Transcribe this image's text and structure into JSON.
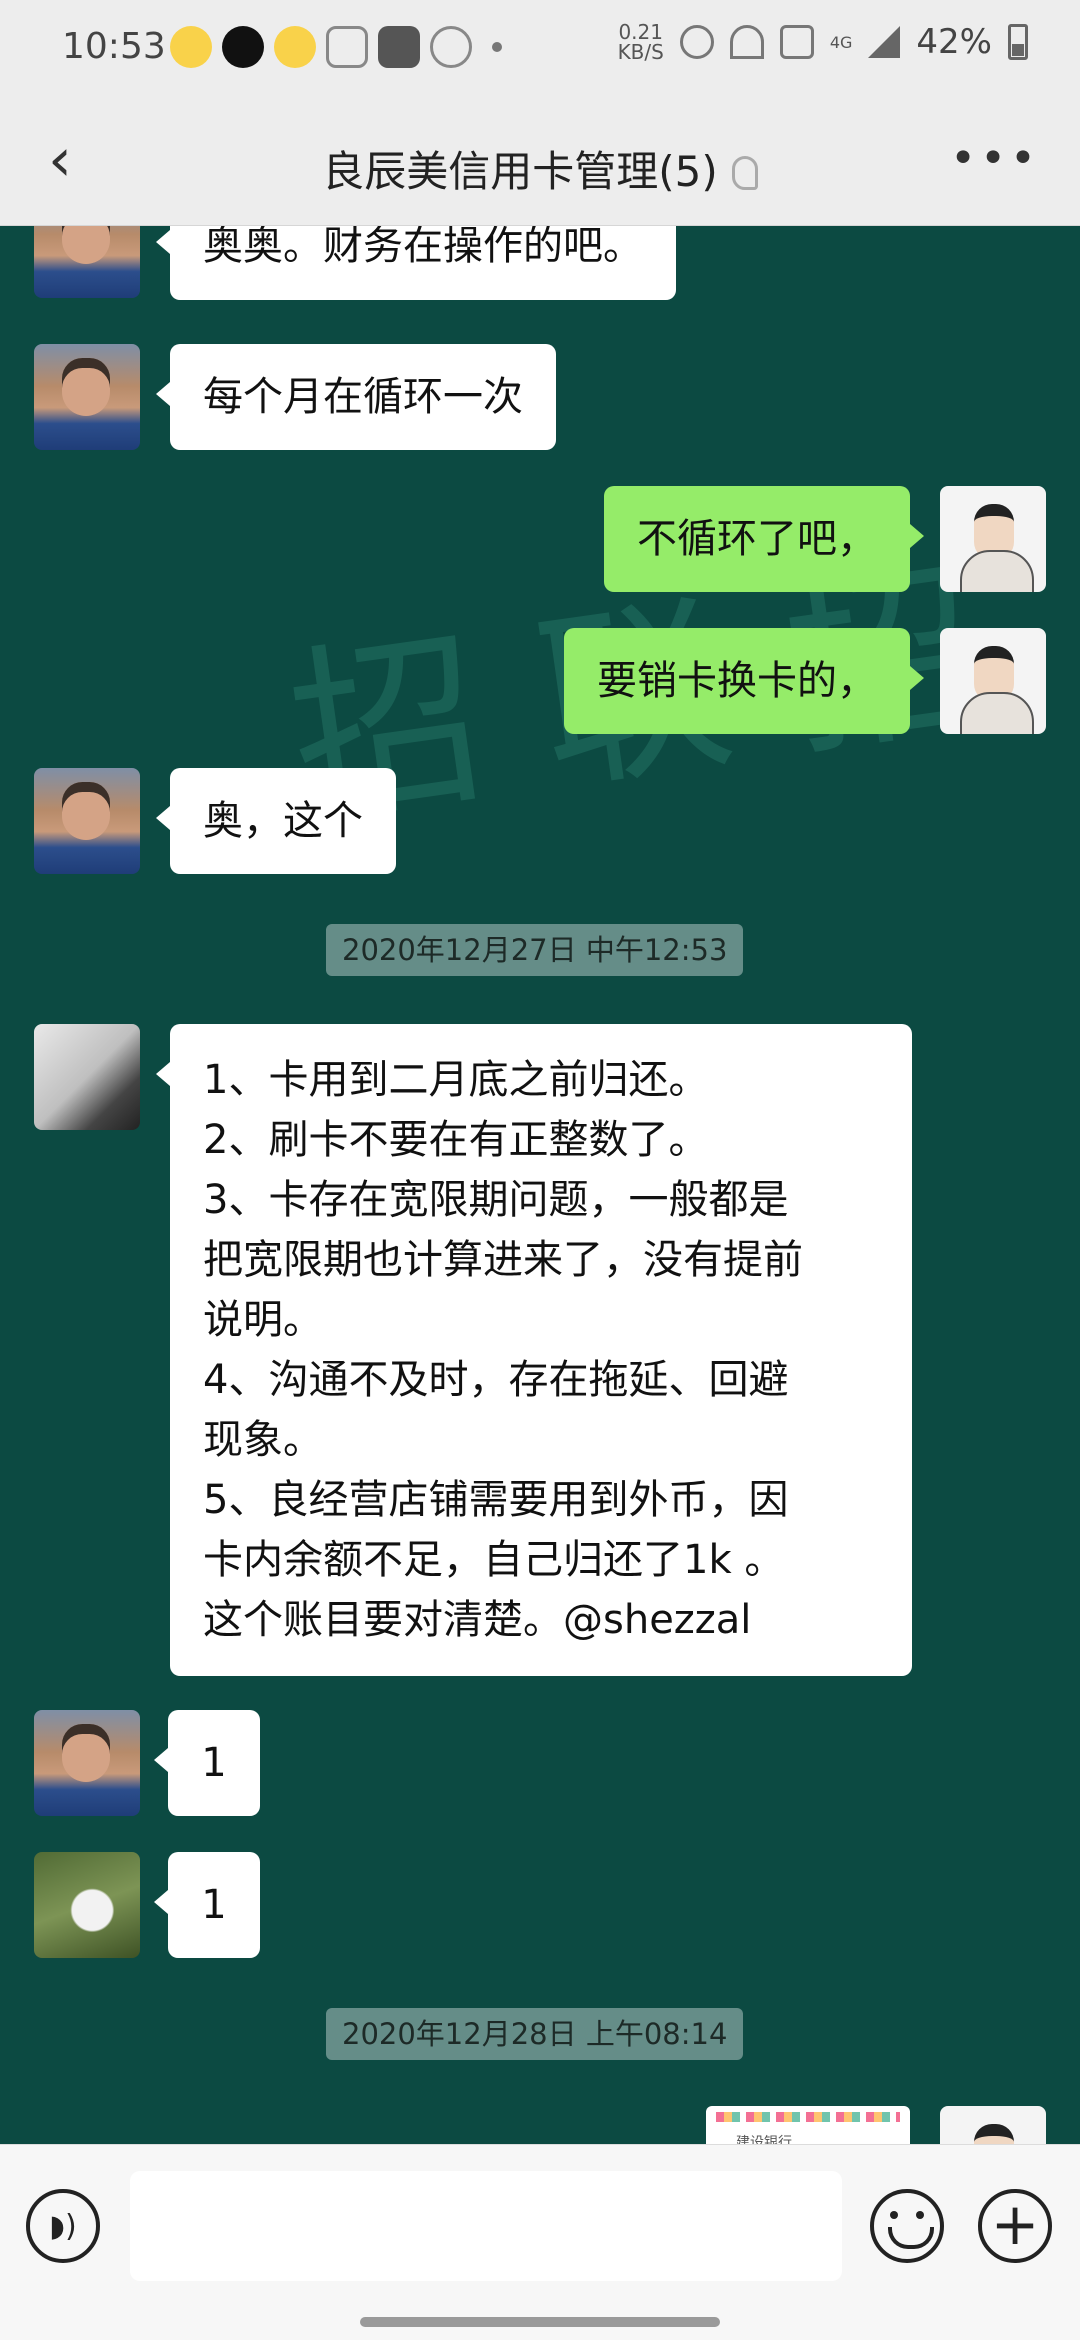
{
  "status_bar": {
    "time": "10:53",
    "net_speed_value": "0.21",
    "net_speed_unit": "KB/S",
    "network": "4G",
    "battery": "42%"
  },
  "header": {
    "title": "良辰美信用卡管理(5)",
    "back_icon": "chevron-left-icon",
    "more_icon": "more-dots-icon"
  },
  "watermark": "招 联 招",
  "messages": [
    {
      "side": "in",
      "avatar": "man",
      "text": "奥奥。财务在操作的吧。"
    },
    {
      "side": "in",
      "avatar": "man",
      "text": "每个月在循环一次"
    },
    {
      "side": "out",
      "avatar": "me",
      "text": "不循环了吧，"
    },
    {
      "side": "out",
      "avatar": "me",
      "text": "要销卡换卡的，"
    },
    {
      "side": "in",
      "avatar": "man",
      "text": "奥，这个"
    },
    {
      "side": "in",
      "avatar": "bw",
      "lines": [
        "1、卡用到二月底之前归还。",
        "2、刷卡不要在有正整数了。",
        "3、卡存在宽限期问题，一般都是",
        "把宽限期也计算进来了，没有提前",
        "说明。",
        "4、沟通不及时，存在拖延、回避",
        "现象。",
        "5、良经营店铺需要用到外币，因",
        "卡内余额不足，自己归还了1k 。",
        "这个账目要对清楚。@shezzal"
      ]
    },
    {
      "side": "in",
      "avatar": "man",
      "text": "1"
    },
    {
      "side": "in",
      "avatar": "rabbit",
      "text": "1"
    }
  ],
  "timestamps": [
    "2020年12月27日 中午12:53",
    "2020年12月28日 上午08:14"
  ],
  "image_message_caption": "建设银行",
  "input_bar": {
    "voice_icon": "voice-icon",
    "emoji_icon": "emoji-icon",
    "plus_symbol": "+"
  }
}
